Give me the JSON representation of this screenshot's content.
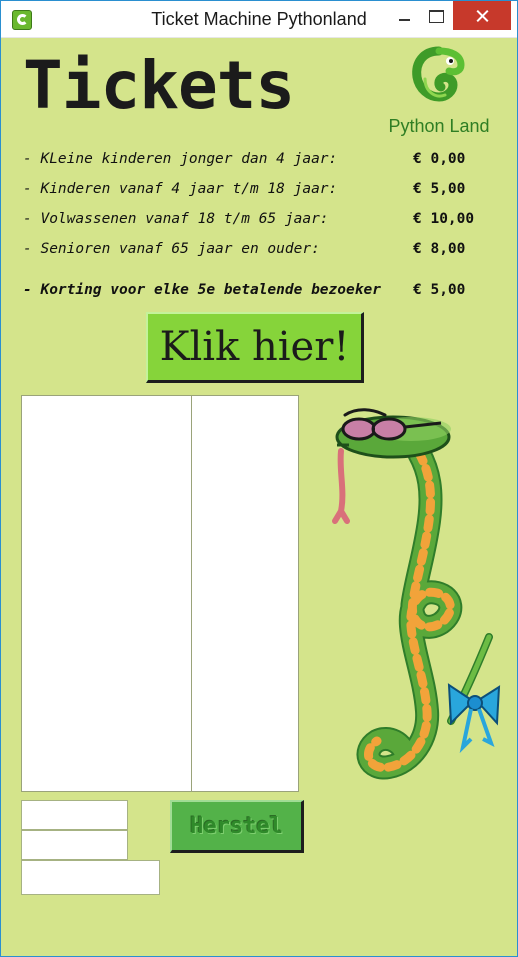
{
  "window": {
    "title": "Ticket Machine Pythonland"
  },
  "heading": "Tickets",
  "logo": {
    "text": "Python Land"
  },
  "prices": [
    {
      "label": "- KLeine kinderen jonger dan 4 jaar:",
      "price": "€ 0,00"
    },
    {
      "label": "- Kinderen vanaf 4 jaar t/m 18 jaar:",
      "price": "€ 5,00"
    },
    {
      "label": "- Volwassenen vanaf 18 t/m 65 jaar:",
      "price": "€ 10,00"
    },
    {
      "label": "- Senioren vanaf 65 jaar en ouder:",
      "price": "€ 8,00"
    },
    {
      "label": "- Korting voor elke 5e betalende bezoeker",
      "price": "€ 5,00"
    }
  ],
  "buttons": {
    "klik": "Klik hier!",
    "reset": "Herstel"
  },
  "entries": {
    "entry1": "",
    "entry2": "",
    "entry3": ""
  },
  "colors": {
    "background": "#d4e48b",
    "klik_button": "#86d43a",
    "reset_button": "#53b249",
    "close_button": "#c7392b"
  },
  "icons": {
    "app": "python-land-icon",
    "logo": "python-land-logo",
    "illustration": "snake-with-glasses-and-bow"
  }
}
